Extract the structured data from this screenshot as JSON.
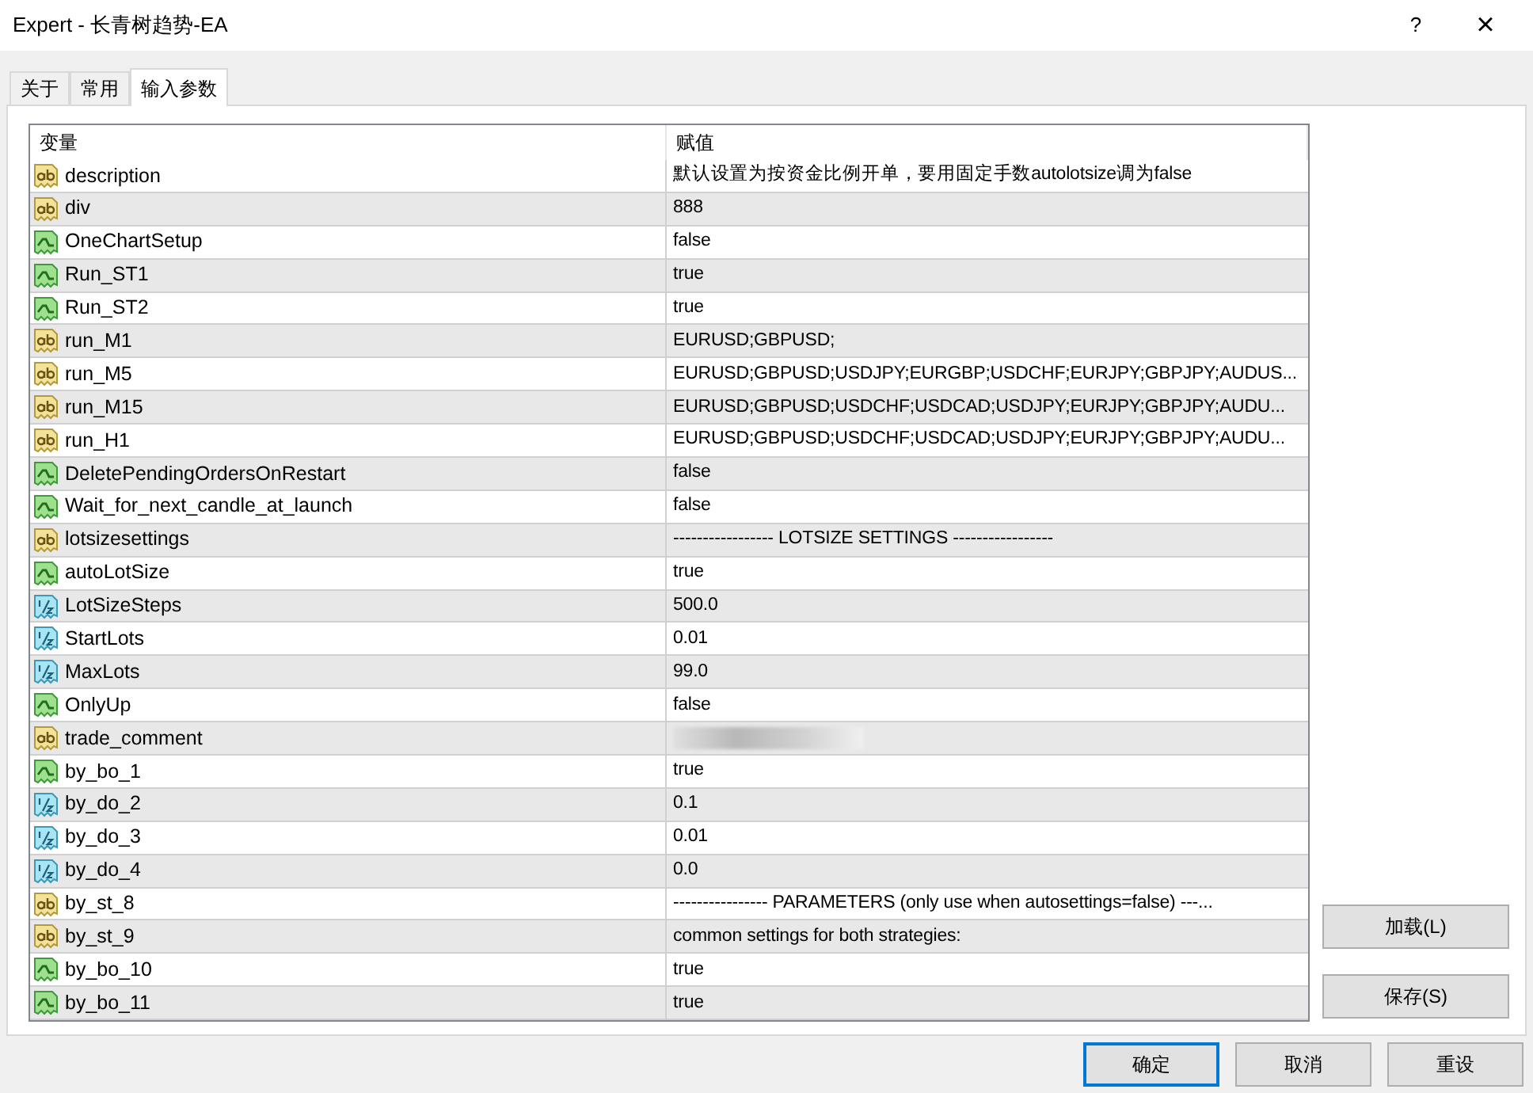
{
  "window": {
    "title": "Expert - 长青树趋势-EA",
    "help": "?",
    "close": "×"
  },
  "tabs": [
    {
      "label": "关于",
      "selected": false
    },
    {
      "label": "常用",
      "selected": false
    },
    {
      "label": "输入参数",
      "selected": true
    }
  ],
  "table": {
    "columns": [
      "变量",
      "赋值"
    ],
    "rows": [
      {
        "kind": "string",
        "name": "description",
        "value": "默认设置为按资金比例开单，要用固定手数autolotsize调为false"
      },
      {
        "kind": "string",
        "name": "div",
        "value": "888"
      },
      {
        "kind": "bool",
        "name": "OneChartSetup",
        "value": "false"
      },
      {
        "kind": "bool",
        "name": "Run_ST1",
        "value": "true"
      },
      {
        "kind": "bool",
        "name": "Run_ST2",
        "value": "true"
      },
      {
        "kind": "string",
        "name": "run_M1",
        "value": "EURUSD;GBPUSD;"
      },
      {
        "kind": "string",
        "name": "run_M5",
        "value": "EURUSD;GBPUSD;USDJPY;EURGBP;USDCHF;EURJPY;GBPJPY;AUDUS..."
      },
      {
        "kind": "string",
        "name": "run_M15",
        "value": "EURUSD;GBPUSD;USDCHF;USDCAD;USDJPY;EURJPY;GBPJPY;AUDU..."
      },
      {
        "kind": "string",
        "name": "run_H1",
        "value": "EURUSD;GBPUSD;USDCHF;USDCAD;USDJPY;EURJPY;GBPJPY;AUDU..."
      },
      {
        "kind": "bool",
        "name": "DeletePendingOrdersOnRestart",
        "value": "false"
      },
      {
        "kind": "bool",
        "name": "Wait_for_next_candle_at_launch",
        "value": "false"
      },
      {
        "kind": "string",
        "name": "lotsizesettings",
        "value": "----------------- LOTSIZE SETTINGS -----------------"
      },
      {
        "kind": "bool",
        "name": "autoLotSize",
        "value": "true"
      },
      {
        "kind": "double",
        "name": "LotSizeSteps",
        "value": "500.0"
      },
      {
        "kind": "double",
        "name": "StartLots",
        "value": "0.01"
      },
      {
        "kind": "double",
        "name": "MaxLots",
        "value": "99.0"
      },
      {
        "kind": "bool",
        "name": "OnlyUp",
        "value": "false"
      },
      {
        "kind": "string",
        "name": "trade_comment",
        "redacted": true
      },
      {
        "kind": "bool",
        "name": "by_bo_1",
        "value": "true"
      },
      {
        "kind": "double",
        "name": "by_do_2",
        "value": "0.1"
      },
      {
        "kind": "double",
        "name": "by_do_3",
        "value": "0.01"
      },
      {
        "kind": "double",
        "name": "by_do_4",
        "value": "0.0"
      },
      {
        "kind": "string",
        "name": "by_st_8",
        "value": "---------------- PARAMETERS (only use when autosettings=false) ---..."
      },
      {
        "kind": "string",
        "name": "by_st_9",
        "value": "common settings for both strategies:"
      },
      {
        "kind": "bool",
        "name": "by_bo_10",
        "value": "true"
      },
      {
        "kind": "bool",
        "name": "by_bo_11",
        "value": "true"
      }
    ]
  },
  "side_buttons": [
    "加载(L)",
    "保存(S)"
  ],
  "footer_buttons": [
    {
      "label": "确定",
      "selected": true
    },
    {
      "label": "取消",
      "selected": false
    },
    {
      "label": "重设",
      "selected": false
    }
  ]
}
